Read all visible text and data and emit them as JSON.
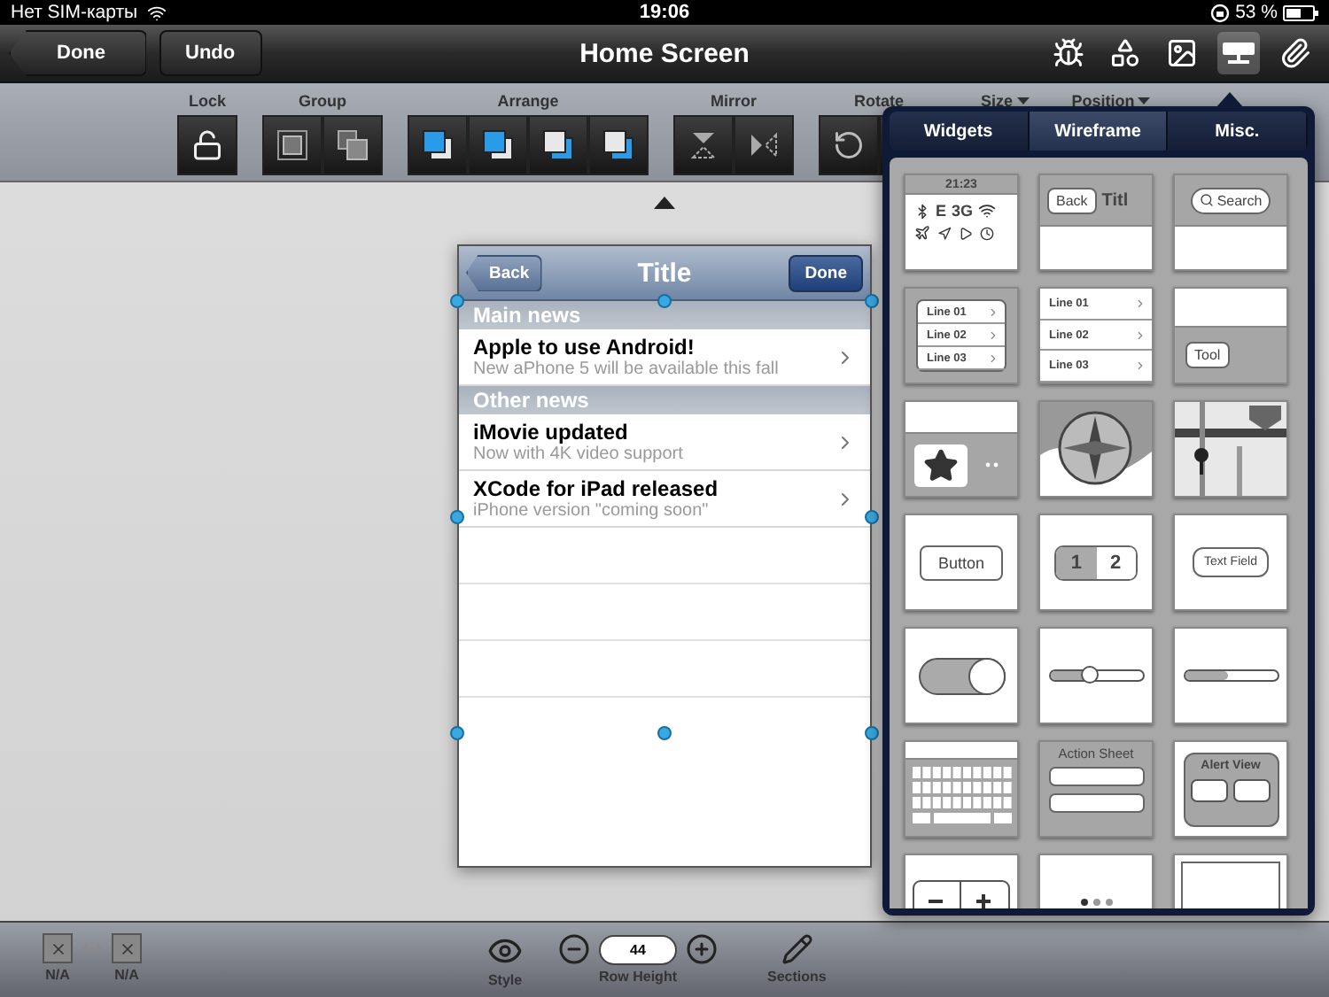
{
  "status_bar": {
    "carrier": "Нет SIM-карты",
    "time": "19:06",
    "battery": "53 %"
  },
  "nav": {
    "buttons": [
      {
        "label": "Done",
        "kind": "back"
      },
      {
        "label": "Undo",
        "kind": "plain"
      }
    ],
    "title": "Home Screen",
    "tools": [
      {
        "kind": "bug",
        "selected": false
      },
      {
        "kind": "shapes",
        "selected": false
      },
      {
        "kind": "image",
        "selected": false
      },
      {
        "kind": "wireframe",
        "selected": true
      },
      {
        "kind": "link",
        "selected": false
      }
    ]
  },
  "toolbar": [
    {
      "label": "Lock",
      "kind": "buttons",
      "tools": [
        {
          "kind": "unlock"
        }
      ]
    },
    {
      "label": "Group",
      "kind": "buttons",
      "tools": [
        {
          "kind": "group"
        },
        {
          "kind": "ungroup"
        }
      ]
    },
    {
      "label": "Arrange",
      "kind": "buttons",
      "tools": [
        {
          "kind": "front"
        },
        {
          "kind": "forward"
        },
        {
          "kind": "backward"
        },
        {
          "kind": "back"
        }
      ]
    },
    {
      "label": "Mirror",
      "kind": "buttons",
      "tools": [
        {
          "kind": "flip-v"
        },
        {
          "kind": "flip-h"
        }
      ]
    },
    {
      "label": "Rotate",
      "kind": "buttons",
      "tools": [
        {
          "kind": "rotate"
        },
        {
          "kind": "blank"
        }
      ]
    },
    {
      "label": "Size",
      "kind": "menu"
    },
    {
      "label": "Position",
      "kind": "menu"
    }
  ],
  "mockup": {
    "back": "Back",
    "title": "Title",
    "done": "Done",
    "sections": [
      {
        "header": "Main news",
        "rows": [
          {
            "title": "Apple to use Android!",
            "subtitle": "New aPhone 5 will be available this fall"
          }
        ]
      },
      {
        "header": "Other news",
        "rows": [
          {
            "title": "iMovie updated",
            "subtitle": "Now with 4K video support"
          },
          {
            "title": "XCode for iPad released",
            "subtitle": "iPhone version \"coming soon\""
          }
        ]
      }
    ]
  },
  "popover": {
    "tabs": [
      {
        "label": "Widgets",
        "selected": false
      },
      {
        "label": "Wireframe",
        "selected": true
      },
      {
        "label": "Misc.",
        "selected": false
      }
    ],
    "tiles": [
      {
        "kind": "statusbar",
        "texts": [
          "21:23",
          "E",
          "3G"
        ]
      },
      {
        "kind": "navbar",
        "texts": [
          "Back",
          "Titl"
        ]
      },
      {
        "kind": "searchbar",
        "texts": [
          "Search"
        ]
      },
      {
        "kind": "grouped-list",
        "texts": [
          "Line 01",
          "Line 02",
          "Line 03"
        ]
      },
      {
        "kind": "plain-list",
        "texts": [
          "Line 01",
          "Line 02",
          "Line 03"
        ]
      },
      {
        "kind": "toolbar",
        "texts": [
          "Tool"
        ]
      },
      {
        "kind": "tabbar"
      },
      {
        "kind": "compass"
      },
      {
        "kind": "map"
      },
      {
        "kind": "button",
        "texts": [
          "Button"
        ]
      },
      {
        "kind": "segmented",
        "texts": [
          "1",
          "2"
        ]
      },
      {
        "kind": "textfield",
        "texts": [
          "Text Field"
        ]
      },
      {
        "kind": "switch"
      },
      {
        "kind": "slider",
        "level": 0.42
      },
      {
        "kind": "progress",
        "level": 0.45
      },
      {
        "kind": "keyboard"
      },
      {
        "kind": "actionsheet",
        "texts": [
          "Action Sheet"
        ]
      },
      {
        "kind": "alertview",
        "texts": [
          "Alert View"
        ]
      },
      {
        "kind": "stepper"
      },
      {
        "kind": "pagecontrol"
      },
      {
        "kind": "page"
      }
    ]
  },
  "bottom_bar": {
    "links": [
      {
        "label": "N/A"
      },
      {
        "label": "N/A"
      }
    ],
    "style": "Style",
    "row_height": {
      "value": "44",
      "label": "Row Height"
    },
    "sections": "Sections"
  }
}
